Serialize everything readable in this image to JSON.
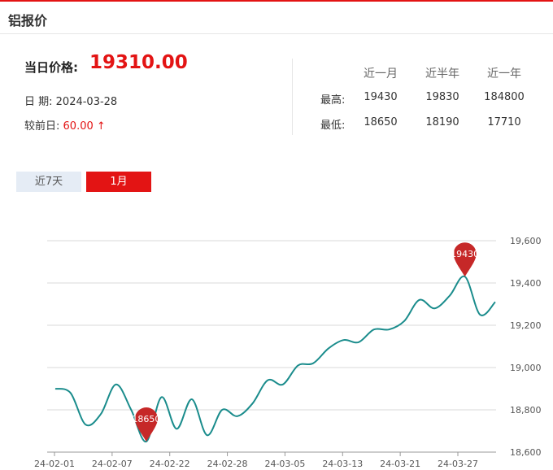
{
  "header": {
    "title": "铝报价"
  },
  "summary": {
    "current_label": "当日价格:",
    "current_value": "19310.00",
    "date_label": "日 期:",
    "date_value": "2024-03-28",
    "change_label": "较前日:",
    "change_value": "60.00 ↑"
  },
  "stats": {
    "headers": [
      "近一月",
      "近半年",
      "近一年"
    ],
    "high_label": "最高:",
    "low_label": "最低:",
    "high_values": [
      "19430",
      "19830",
      "184800"
    ],
    "low_values": [
      "18650",
      "18190",
      "17710"
    ]
  },
  "tabs": {
    "seven_days": "近7天",
    "one_month": "1月"
  },
  "colors": {
    "accent": "#e31414",
    "line": "#1a8c8c",
    "marker": "#c62828"
  },
  "chart_data": {
    "type": "line",
    "x_tick_labels": [
      "24-02-01",
      "24-02-07",
      "24-02-22",
      "24-02-28",
      "24-03-05",
      "24-03-13",
      "24-03-21",
      "24-03-27"
    ],
    "y_tick_labels": [
      "19,600",
      "19,400",
      "19,200",
      "19,000",
      "18,800",
      "18,600"
    ],
    "ylim": [
      18600,
      19600
    ],
    "grid": "horizontal",
    "series": [
      {
        "values": [
          18900,
          18880,
          18730,
          18780,
          18920,
          18800,
          18650,
          18860,
          18710,
          18850,
          18680,
          18800,
          18770,
          18830,
          18940,
          18920,
          19010,
          19020,
          19090,
          19130,
          19120,
          19180,
          19180,
          19220,
          19320,
          19280,
          19340,
          19430,
          19250,
          19310
        ]
      }
    ],
    "markers": [
      {
        "label": "18650",
        "value": 18650,
        "index": 6
      },
      {
        "label": "19430",
        "value": 19430,
        "index": 27
      }
    ]
  }
}
